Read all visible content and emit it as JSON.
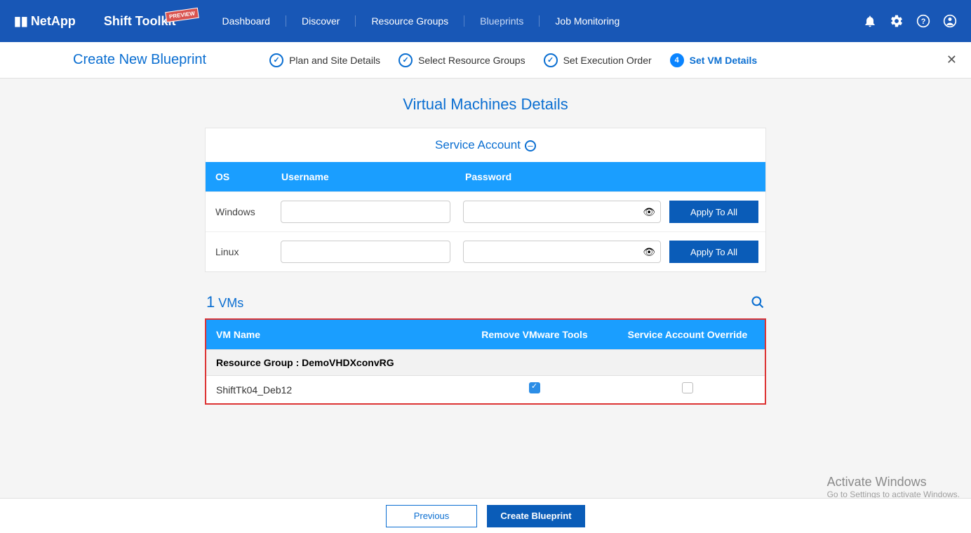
{
  "topbar": {
    "brand": "NetApp",
    "product": "Shift Toolkit",
    "preview": "PREVIEW",
    "nav": [
      "Dashboard",
      "Discover",
      "Resource Groups",
      "Blueprints",
      "Job Monitoring"
    ]
  },
  "page_title": "Create New Blueprint",
  "steps": [
    "Plan and Site Details",
    "Select Resource Groups",
    "Set Execution Order",
    "Set VM Details"
  ],
  "active_step_index": 3,
  "section_title": "Virtual Machines Details",
  "service_account_title": "Service Account",
  "sa_headers": {
    "os": "OS",
    "user": "Username",
    "pass": "Password"
  },
  "sa_rows": [
    {
      "os": "Windows",
      "apply": "Apply To All"
    },
    {
      "os": "Linux",
      "apply": "Apply To All"
    }
  ],
  "vms_count": "1",
  "vms_label": "VMs",
  "vm_headers": {
    "name": "VM Name",
    "remove": "Remove VMware Tools",
    "override": "Service Account Override"
  },
  "group_label": "Resource Group : DemoVHDXconvRG",
  "vm_row": {
    "name": "ShiftTk04_Deb12",
    "remove": true,
    "override": false
  },
  "footer": {
    "prev": "Previous",
    "create": "Create Blueprint"
  },
  "watermark": {
    "t1": "Activate Windows",
    "t2": "Go to Settings to activate Windows."
  }
}
